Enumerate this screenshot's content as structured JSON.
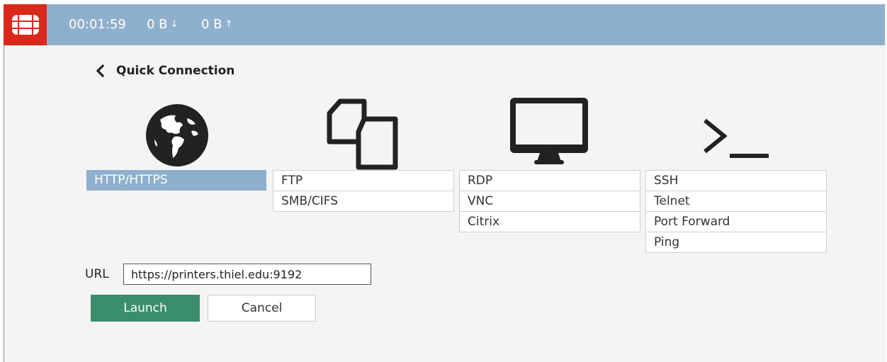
{
  "header": {
    "logo_icon": "fortinet-logo-icon",
    "timer": "00:01:59",
    "download": "0 B",
    "upload": "0 B",
    "download_icon": "arrow-down-icon",
    "upload_icon": "arrow-up-icon"
  },
  "page": {
    "back_icon": "chevron-left-icon",
    "title": "Quick Connection"
  },
  "groups": [
    {
      "icon": "globe-icon",
      "items": [
        "HTTP/HTTPS"
      ],
      "selected": 0
    },
    {
      "icon": "files-icon",
      "items": [
        "FTP",
        "SMB/CIFS"
      ]
    },
    {
      "icon": "monitor-icon",
      "items": [
        "RDP",
        "VNC",
        "Citrix"
      ]
    },
    {
      "icon": "terminal-icon",
      "items": [
        "SSH",
        "Telnet",
        "Port Forward",
        "Ping"
      ]
    }
  ],
  "form": {
    "url_label": "URL",
    "url_value": "https://printers.thiel.edu:9192",
    "launch_label": "Launch",
    "cancel_label": "Cancel"
  },
  "colors": {
    "topbar": "#8fb0cc",
    "logo": "#da291c",
    "selected": "#8fb0cc",
    "launch": "#3a8e6d"
  }
}
